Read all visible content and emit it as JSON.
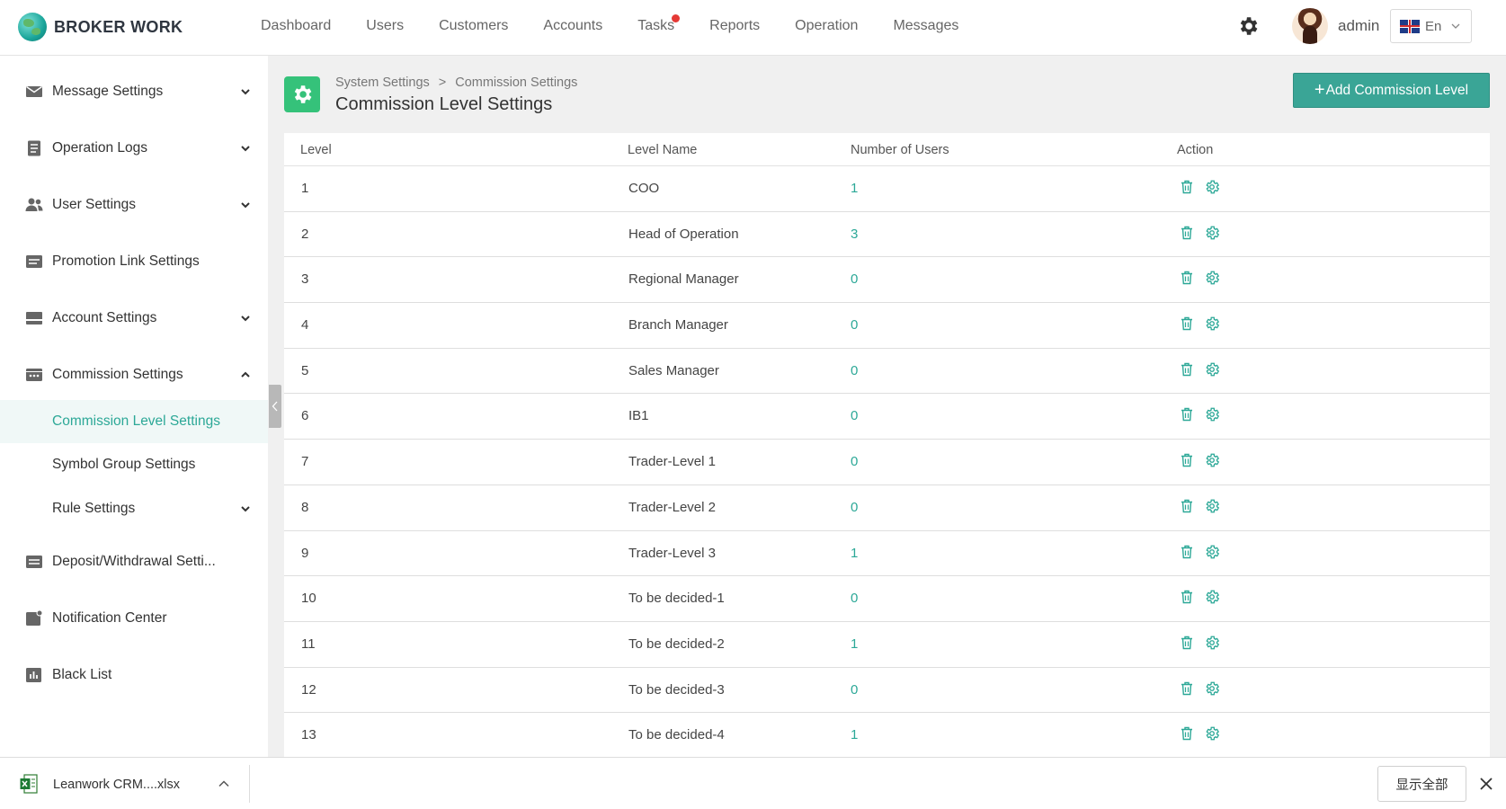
{
  "brand": {
    "name": "BROKER WORK",
    "logo_icon": "globe-icon"
  },
  "nav": {
    "items": [
      "Dashboard",
      "Users",
      "Customers",
      "Accounts",
      "Tasks",
      "Reports",
      "Operation",
      "Messages"
    ],
    "notification_on": "Tasks"
  },
  "user": {
    "name": "admin",
    "language": "En"
  },
  "sidebar": {
    "items": [
      {
        "label": "Message Settings",
        "icon": "envelope-icon",
        "chevron": "down"
      },
      {
        "label": "Operation Logs",
        "icon": "log-icon",
        "chevron": "down"
      },
      {
        "label": "User Settings",
        "icon": "users-icon",
        "chevron": "down"
      },
      {
        "label": "Promotion Link Settings",
        "icon": "link-card-icon",
        "chevron": ""
      },
      {
        "label": "Account Settings",
        "icon": "account-card-icon",
        "chevron": "down"
      },
      {
        "label": "Commission Settings",
        "icon": "commission-icon",
        "chevron": "up"
      },
      {
        "label": "Commission Level Settings",
        "icon": "",
        "chevron": "",
        "active": true
      },
      {
        "label": "Symbol Group Settings",
        "icon": "",
        "chevron": ""
      },
      {
        "label": "Rule Settings",
        "icon": "",
        "chevron": "down"
      },
      {
        "label": "Deposit/Withdrawal Setti...",
        "icon": "deposit-icon",
        "chevron": ""
      },
      {
        "label": "Notification Center",
        "icon": "notification-icon",
        "chevron": ""
      },
      {
        "label": "Black List",
        "icon": "chart-icon",
        "chevron": ""
      }
    ]
  },
  "header": {
    "breadcrumb": [
      "System Settings",
      ">",
      "Commission Settings"
    ],
    "title": "Commission Level Settings",
    "add_button": "Add Commission Level",
    "add_button_plus": "+"
  },
  "table": {
    "columns": [
      "Level",
      "Level Name",
      "Number of Users",
      "Action"
    ],
    "rows": [
      {
        "level": "1",
        "name": "COO",
        "users": "1"
      },
      {
        "level": "2",
        "name": "Head of Operation",
        "users": "3"
      },
      {
        "level": "3",
        "name": "Regional Manager",
        "users": "0"
      },
      {
        "level": "4",
        "name": "Branch Manager",
        "users": "0"
      },
      {
        "level": "5",
        "name": "Sales Manager",
        "users": "0"
      },
      {
        "level": "6",
        "name": "IB1",
        "users": "0"
      },
      {
        "level": "7",
        "name": "Trader-Level 1",
        "users": "0"
      },
      {
        "level": "8",
        "name": "Trader-Level 2",
        "users": "0"
      },
      {
        "level": "9",
        "name": "Trader-Level 3",
        "users": "1"
      },
      {
        "level": "10",
        "name": "To be decided-1",
        "users": "0"
      },
      {
        "level": "11",
        "name": "To be decided-2",
        "users": "1"
      },
      {
        "level": "12",
        "name": "To be decided-3",
        "users": "0"
      },
      {
        "level": "13",
        "name": "To be decided-4",
        "users": "1"
      }
    ]
  },
  "download_bar": {
    "file_name": "Leanwork CRM....xlsx",
    "show_all": "显示全部"
  },
  "colors": {
    "accent": "#3aa596",
    "link": "#2ca897",
    "page_icon": "#35c27a",
    "notify": "#e53935"
  }
}
